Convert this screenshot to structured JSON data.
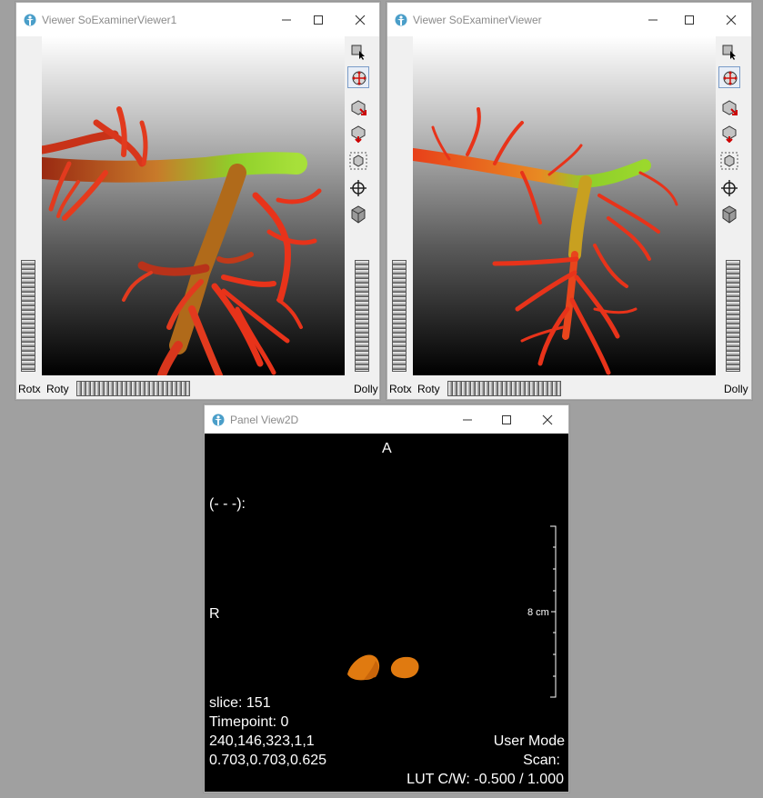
{
  "viewer1": {
    "title": "Viewer SoExaminerViewer1",
    "labels": {
      "rotx": "Rotx",
      "roty": "Roty",
      "dolly": "Dolly"
    },
    "tools": [
      "pick-arrow-icon",
      "rotate-view-icon",
      "seek-icon",
      "home-icon",
      "view-all-icon",
      "seek-target-icon",
      "projection-cube-icon"
    ]
  },
  "viewer2": {
    "title": "Viewer SoExaminerViewer",
    "labels": {
      "rotx": "Rotx",
      "roty": "Roty",
      "dolly": "Dolly"
    },
    "tools": [
      "pick-arrow-icon",
      "rotate-view-icon",
      "seek-icon",
      "home-icon",
      "view-all-icon",
      "seek-target-icon",
      "projection-cube-icon"
    ]
  },
  "panel2d": {
    "title": "Panel View2D",
    "orientation_top": "A",
    "orientation_left": "R",
    "cursor_label": "(- - -):",
    "scale_label": "8 cm",
    "slice": "slice:  151",
    "timepoint": "Timepoint: 0",
    "dims": "240,146,323,1,1",
    "spacing": "0.703,0.703,0.625",
    "mode": "User Mode",
    "scan": "Scan:",
    "lut": "LUT C/W: -0.500 / 1.000"
  },
  "colors": {
    "desktop": "#a0a0a0",
    "vessel_red": "#e8301a",
    "vessel_green": "#8fd21f",
    "lesion_orange": "#e07a10"
  }
}
